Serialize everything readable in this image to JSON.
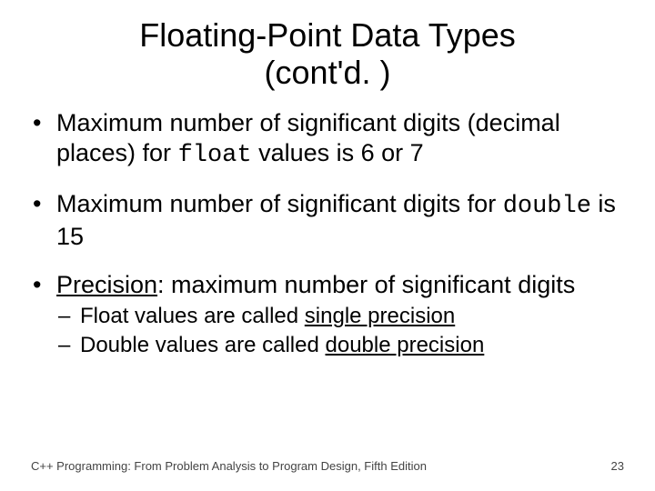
{
  "title_line1": "Floating-Point Data Types",
  "title_line2": "(cont'd. )",
  "bullets": {
    "b1": {
      "pre": "Maximum number of significant digits (decimal places) for ",
      "code": "float",
      "post": " values is 6 or 7"
    },
    "b2": {
      "pre": "Maximum number of significant digits for ",
      "code": "double",
      "post": " is 15"
    },
    "b3": {
      "term": "Precision",
      "rest": ": maximum number of significant digits",
      "sub1": {
        "pre": "Float values are called ",
        "u": "single precision"
      },
      "sub2": {
        "pre": "Double values are called ",
        "u": "double precision"
      }
    }
  },
  "footer": {
    "source": "C++ Programming: From Problem Analysis to Program Design, Fifth Edition",
    "page": "23"
  }
}
